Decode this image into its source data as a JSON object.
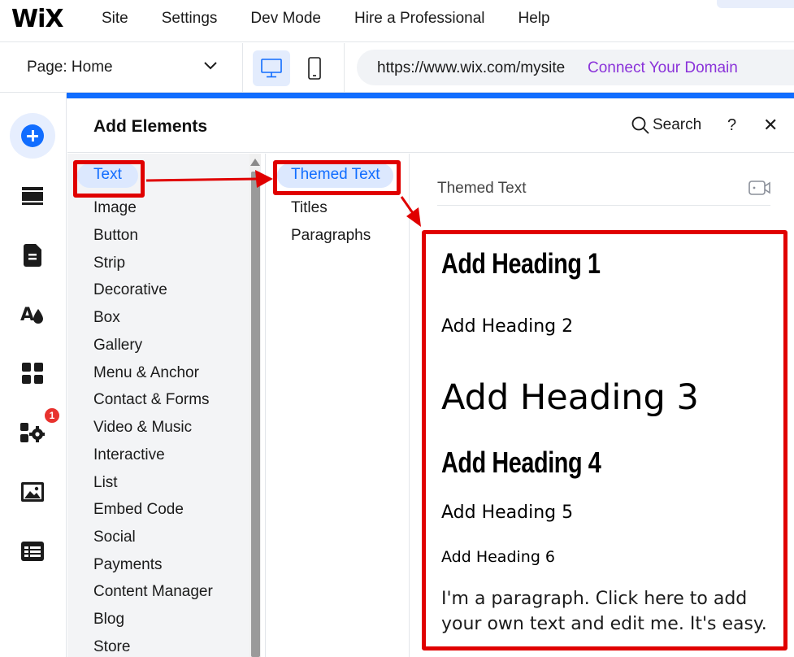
{
  "topbar": {
    "logo": "WiX",
    "menu": [
      "Site",
      "Settings",
      "Dev Mode",
      "Hire a Professional",
      "Help"
    ]
  },
  "toolbar": {
    "page_label": "Page: Home",
    "url": "https://www.wix.com/mysite",
    "connect_domain": "Connect Your Domain",
    "selected_device": "desktop"
  },
  "rail": {
    "items": [
      "add-elements",
      "sections",
      "pages",
      "site-design",
      "apps",
      "business-tools",
      "media",
      "cms"
    ],
    "notification_count": "1"
  },
  "panel": {
    "title": "Add Elements",
    "search_label": "Search",
    "help_label": "?",
    "close_label": "✕",
    "categories": [
      "Text",
      "Image",
      "Button",
      "Strip",
      "Decorative",
      "Box",
      "Gallery",
      "Menu & Anchor",
      "Contact & Forms",
      "Video & Music",
      "Interactive",
      "List",
      "Embed Code",
      "Social",
      "Payments",
      "Content Manager",
      "Blog",
      "Store"
    ],
    "active_category": "Text",
    "subcategories": [
      "Themed Text",
      "Titles",
      "Paragraphs"
    ],
    "active_subcategory": "Themed Text",
    "preview": {
      "section_title": "Themed Text",
      "headings": [
        "Add Heading 1",
        "Add Heading 2",
        "Add Heading 3",
        "Add Heading 4",
        "Add Heading 5",
        "Add Heading 6"
      ],
      "paragraph": "I'm a paragraph. Click here to add your own text and edit me. It's easy."
    }
  },
  "colors": {
    "accent": "#116dff",
    "active_bg": "#dce8fe",
    "annotation": "#e00000",
    "connect_link": "#8a32d9",
    "badge": "#e8322e"
  }
}
